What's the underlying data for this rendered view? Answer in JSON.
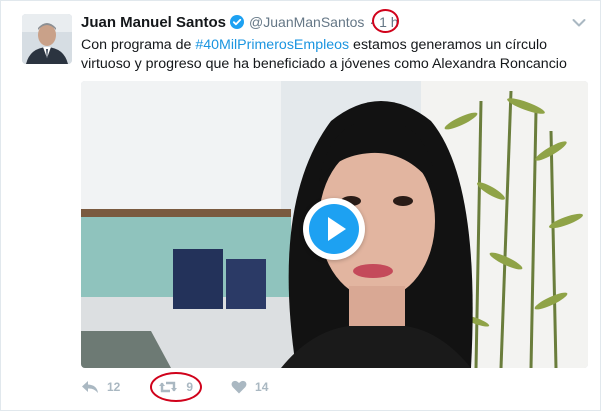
{
  "tweet": {
    "author_name": "Juan Manuel Santos",
    "handle": "@JuanManSantos",
    "separator": "·",
    "time": "1 h",
    "text_before": "Con programa de ",
    "hashtag": "#40MilPrimerosEmpleos",
    "text_after": " estamos generamos un círculo virtuoso y progreso que ha beneficiado a jóvenes como Alexandra Roncancio",
    "actions": {
      "reply_count": "12",
      "retweet_count": "9",
      "like_count": "14"
    }
  },
  "colors": {
    "link": "#1b95e0",
    "verified": "#1da1f2",
    "highlight_circle": "#d0021b",
    "icon_gray": "#aab8c2"
  },
  "icons": {
    "verified": "verified-badge-icon",
    "caret": "chevron-down-icon",
    "play": "play-icon",
    "reply": "reply-icon",
    "retweet": "retweet-icon",
    "like": "heart-icon"
  }
}
